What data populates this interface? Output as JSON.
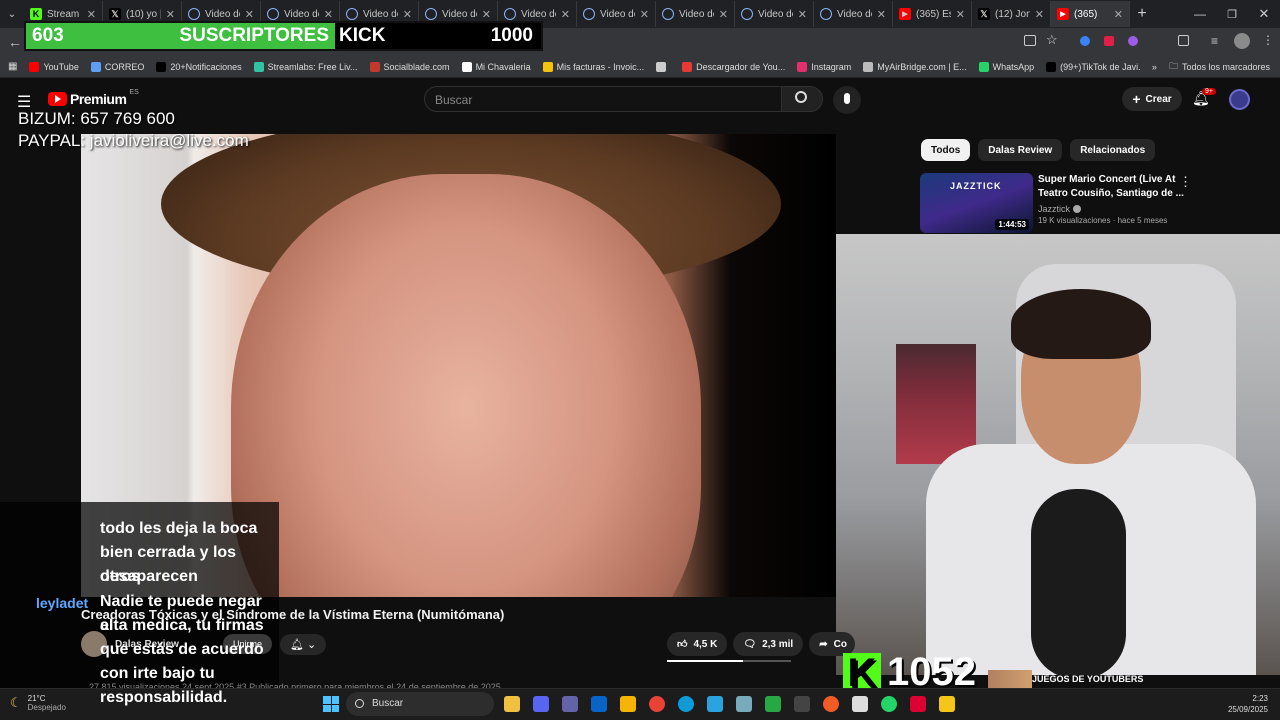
{
  "browser": {
    "tabs": [
      {
        "label": "Stream",
        "icon": "kick-icon",
        "color": "#53fc18"
      },
      {
        "label": "(10) yo |",
        "icon": "x-icon",
        "color": "#000000"
      },
      {
        "label": "Video de",
        "icon": "globe-icon",
        "color": "#8ab4f8"
      },
      {
        "label": "Video de",
        "icon": "globe-icon",
        "color": "#8ab4f8"
      },
      {
        "label": "Video de",
        "icon": "globe-icon",
        "color": "#8ab4f8"
      },
      {
        "label": "Video de",
        "icon": "globe-icon",
        "color": "#8ab4f8"
      },
      {
        "label": "Video de",
        "icon": "globe-icon",
        "color": "#8ab4f8"
      },
      {
        "label": "Video de",
        "icon": "globe-icon",
        "color": "#8ab4f8"
      },
      {
        "label": "Video de",
        "icon": "globe-icon",
        "color": "#8ab4f8"
      },
      {
        "label": "Video de",
        "icon": "globe-icon",
        "color": "#8ab4f8"
      },
      {
        "label": "Video de",
        "icon": "globe-icon",
        "color": "#8ab4f8"
      },
      {
        "label": "(365) Es",
        "icon": "youtube-icon",
        "color": "#ff0000"
      },
      {
        "label": "(12) Jon",
        "icon": "x-icon",
        "color": "#000000"
      },
      {
        "label": "(365)",
        "icon": "youtube-icon",
        "color": "#ff0000"
      }
    ],
    "bookmarks": [
      {
        "label": "YouTube",
        "icon": "youtube-icon",
        "color": "#ff0000"
      },
      {
        "label": "CORREO",
        "icon": "mail-icon",
        "color": "#5f9df7"
      },
      {
        "label": "20+Notificaciones",
        "icon": "x-icon",
        "color": "#000000"
      },
      {
        "label": "Streamlabs: Free Liv...",
        "icon": "streamlabs-icon",
        "color": "#31c3a2"
      },
      {
        "label": "Socialblade.com",
        "icon": "socialblade-icon",
        "color": "#c0392b"
      },
      {
        "label": "Mi Chavaleria",
        "icon": "globe-icon",
        "color": "#ffffff"
      },
      {
        "label": "Mis facturas - Invoic...",
        "icon": "invoice-icon",
        "color": "#f4c20d"
      },
      {
        "label": "",
        "icon": "globe-icon",
        "color": "#cccccc"
      },
      {
        "label": "Descargador de You...",
        "icon": "download-icon",
        "color": "#e53935"
      },
      {
        "label": "Instagram",
        "icon": "instagram-icon",
        "color": "#e1306c"
      },
      {
        "label": "MyAirBridge.com | E...",
        "icon": "cloud-icon",
        "color": "#bbbbbb"
      },
      {
        "label": "WhatsApp",
        "icon": "whatsapp-icon",
        "color": "#25d366"
      },
      {
        "label": "(99+)TikTok de Javi...",
        "icon": "tiktok-icon",
        "color": "#000000"
      }
    ],
    "all_bookmarks": "Todos los marcadores"
  },
  "overlay": {
    "subs_count": "603",
    "subs_label": "SUSCRIPTORES",
    "kick_label": "KICK",
    "kick_goal": "1000",
    "bizum": "BIZUM: 657 769 600",
    "paypal": "PAYPAL: javioliveira@live.com",
    "kick_count": "1052",
    "chat_user": "leyladet",
    "captions": [
      "todo les deja la boca",
      "bien cerrada y los otros",
      "desaparecen",
      "Nadie te puede negar el",
      "alta medica, tu firmas",
      "que estás de acuerdo",
      "con irte bajo tu",
      "responsabilidad."
    ],
    "bottom_banner": "JUEGOS DE YOUTUBERS"
  },
  "youtube": {
    "logo_label": "Premium",
    "region": "ES",
    "search_placeholder": "Buscar",
    "create_label": "Crear",
    "notif_badge": "9+",
    "video_title": "Creadoras Tóxicas y el Síndrome de la Vístima Eterna (Numitómana)",
    "channel_name": "Dalas Review",
    "join_label": "Unirme",
    "likes": "4,5 K",
    "comments": "2,3 mil",
    "share_label": "Co",
    "meta": "27.815 visualizaciones  24 sept 2025  #3 Publicado primero para miembros el 24 de septiembre de 2025",
    "filters": [
      "Todos",
      "Dalas Review",
      "Relacionados"
    ],
    "reco": {
      "title_line1": "Super Mario Concert (Live At",
      "title_line2": "Teatro Cousiño, Santiago de ...",
      "channel": "Jazztick",
      "stats": "19 K visualizaciones · hace 5 meses",
      "duration": "1:44:53",
      "thumb_text": "JAZZTICK"
    }
  },
  "taskbar": {
    "weather_temp": "21°C",
    "weather_desc": "Despejado",
    "search_label": "Buscar",
    "time": "2:23",
    "date": "25/09/2025"
  }
}
